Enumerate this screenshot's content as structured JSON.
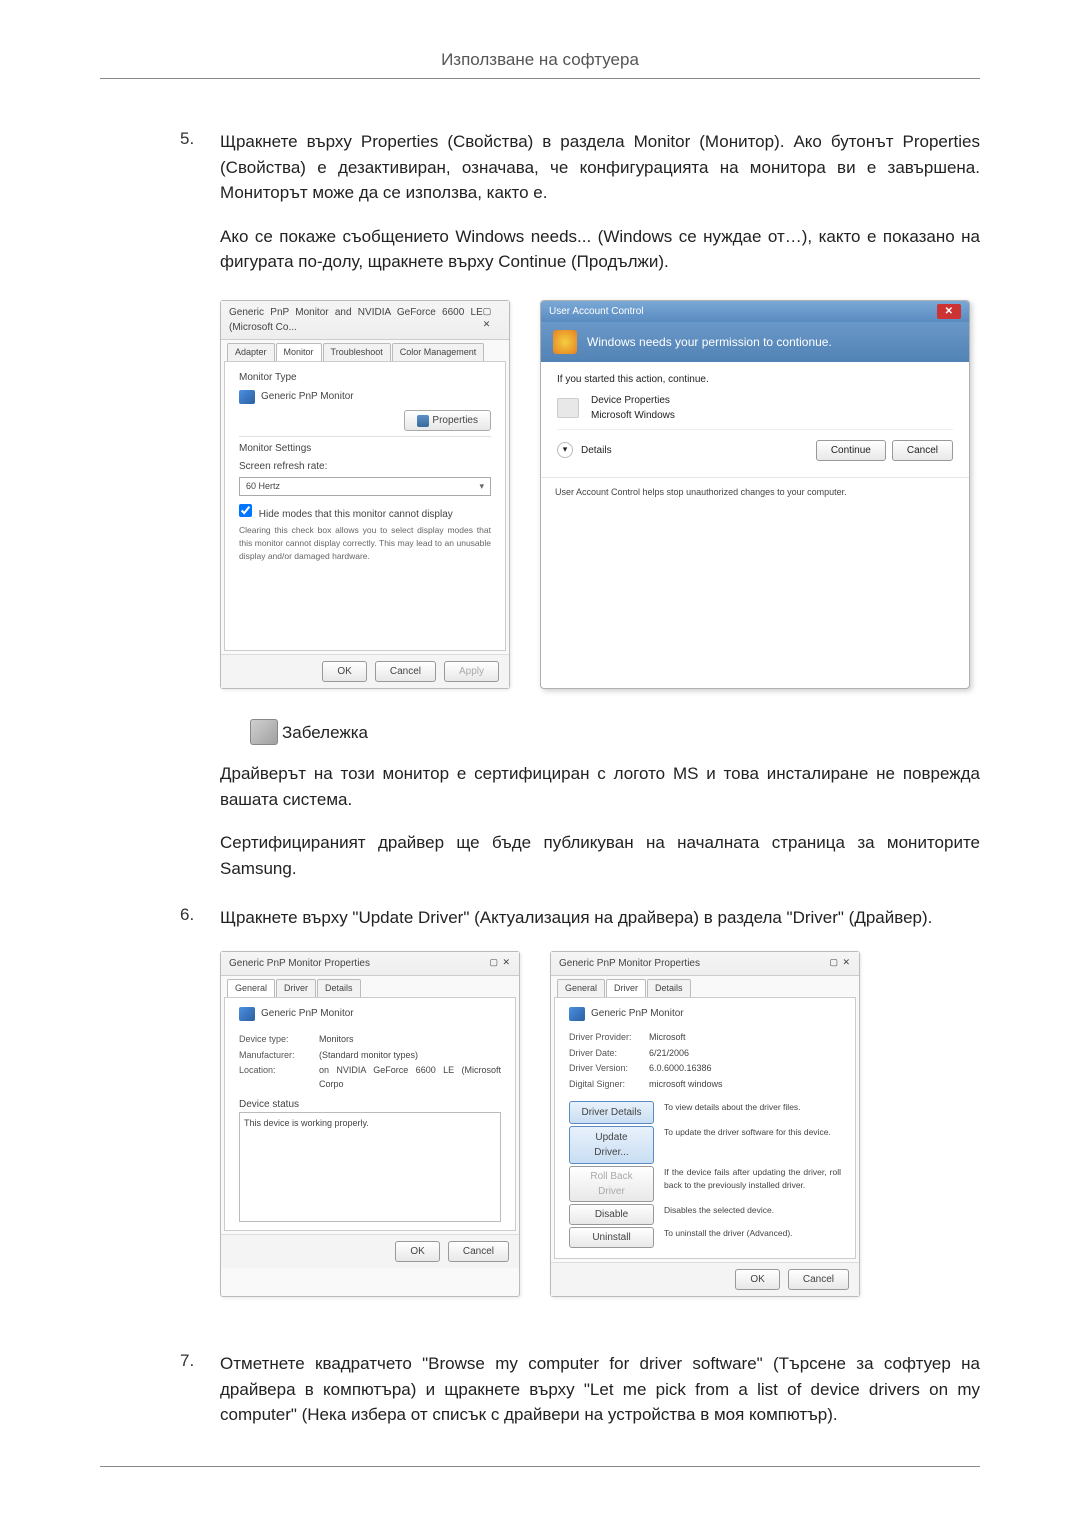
{
  "header": {
    "title": "Използване на софтуера"
  },
  "step5": {
    "num": "5.",
    "p1": "Щракнете върху Properties (Свойства) в раздела Monitor (Монитор). Ако бутонът Properties (Свойства) е дезактивиран, означава, че конфигурацията на монитора ви е завършена. Мониторът може да се използва, както е.",
    "p2": "Ако се покаже съобщението Windows needs... (Windows се нуждае от…), както е показано на фигурата по-долу, щракнете върху Continue (Продължи)."
  },
  "dialog1": {
    "title": "Generic PnP Monitor and NVIDIA GeForce 6600 LE (Microsoft Co...",
    "tabs": {
      "adapter": "Adapter",
      "monitor": "Monitor",
      "troubleshoot": "Troubleshoot",
      "colorManagement": "Color Management"
    },
    "monitorType": "Monitor Type",
    "genericPnP": "Generic PnP Monitor",
    "properties": "Properties",
    "monitorSettings": "Monitor Settings",
    "refreshRate": "Screen refresh rate:",
    "hz": "60 Hertz",
    "hideModes": "Hide modes that this monitor cannot display",
    "hideModesDesc": "Clearing this check box allows you to select display modes that this monitor cannot display correctly. This may lead to an unusable display and/or damaged hardware.",
    "ok": "OK",
    "cancel": "Cancel",
    "apply": "Apply"
  },
  "uac": {
    "title": "User Account Control",
    "headline": "Windows needs your permission to contionue.",
    "ifStarted": "If you started this action, continue.",
    "deviceProps": "Device Properties",
    "msWindows": "Microsoft Windows",
    "details": "Details",
    "continue": "Continue",
    "cancel": "Cancel",
    "footer": "User Account Control helps stop unauthorized changes to your computer."
  },
  "note": {
    "title": "Забележка",
    "p1": "Драйверът на този монитор е сертифициран с логото MS и това инсталиране не поврежда вашата система.",
    "p2": "Сертифицираният драйвер ще бъде публикуван на началната страница за мониторите Samsung."
  },
  "step6": {
    "num": "6.",
    "p1": "Щракнете върху \"Update Driver\" (Актуализация на драйвера) в раздела \"Driver\" (Драйвер)."
  },
  "dialog3": {
    "title": "Generic PnP Monitor Properties",
    "tabs": {
      "general": "General",
      "driver": "Driver",
      "details": "Details"
    },
    "genericPnP": "Generic PnP Monitor",
    "deviceType": "Device type:",
    "deviceTypeVal": "Monitors",
    "manufacturer": "Manufacturer:",
    "manufacturerVal": "(Standard monitor types)",
    "location": "Location:",
    "locationVal": "on NVIDIA GeForce 6600 LE (Microsoft Corpo",
    "deviceStatus": "Device status",
    "working": "This device is working properly.",
    "ok": "OK",
    "cancel": "Cancel"
  },
  "dialog4": {
    "title": "Generic PnP Monitor Properties",
    "tabs": {
      "general": "General",
      "driver": "Driver",
      "details": "Details"
    },
    "genericPnP": "Generic PnP Monitor",
    "driverProvider": "Driver Provider:",
    "driverProviderVal": "Microsoft",
    "driverDate": "Driver Date:",
    "driverDateVal": "6/21/2006",
    "driverVersion": "Driver Version:",
    "driverVersionVal": "6.0.6000.16386",
    "digitalSigner": "Digital Signer:",
    "digitalSignerVal": "microsoft windows",
    "driverDetails": "Driver Details",
    "driverDetailsDesc": "To view details about the driver files.",
    "updateDriver": "Update Driver...",
    "updateDriverDesc": "To update the driver software for this device.",
    "rollBack": "Roll Back Driver",
    "rollBackDesc": "If the device fails after updating the driver, roll back to the previously installed driver.",
    "disable": "Disable",
    "disableDesc": "Disables the selected device.",
    "uninstall": "Uninstall",
    "uninstallDesc": "To uninstall the driver (Advanced).",
    "ok": "OK",
    "cancel": "Cancel"
  },
  "step7": {
    "num": "7.",
    "p1": "Отметнете квадратчето \"Browse my computer for driver software\" (Търсене за софтуер на драйвера в компютъра) и щракнете върху \"Let me pick from a list of device drivers on my computer\" (Нека избера от списък с драйвери на устройства в моя компютър)."
  }
}
